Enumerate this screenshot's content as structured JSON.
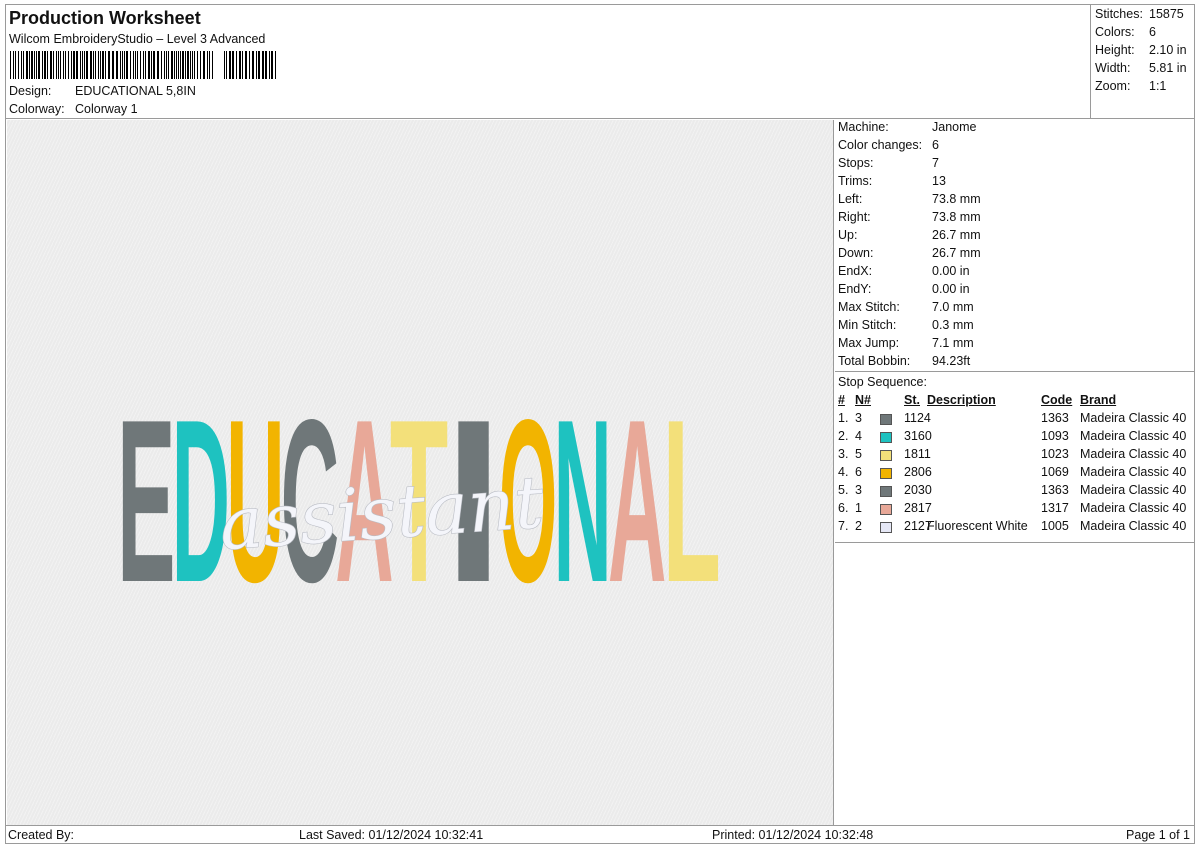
{
  "header": {
    "title": "Production Worksheet",
    "subtitle": "Wilcom EmbroideryStudio – Level 3 Advanced",
    "design_label": "Design:",
    "design_value": "EDUCATIONAL 5,8IN",
    "colorway_label": "Colorway:",
    "colorway_value": "Colorway 1"
  },
  "stats": [
    {
      "label": "Stitches:",
      "value": "15875"
    },
    {
      "label": "Colors:",
      "value": "6"
    },
    {
      "label": "Height:",
      "value": "2.10 in"
    },
    {
      "label": "Width:",
      "value": "5.81 in"
    },
    {
      "label": "Zoom:",
      "value": "1:1"
    }
  ],
  "machine_info": [
    {
      "label": "Machine:",
      "value": "Janome"
    },
    {
      "label": "Color changes:",
      "value": "6"
    },
    {
      "label": "Stops:",
      "value": "7"
    },
    {
      "label": "Trims:",
      "value": "13"
    },
    {
      "label": "Left:",
      "value": "73.8 mm"
    },
    {
      "label": "Right:",
      "value": "73.8 mm"
    },
    {
      "label": "Up:",
      "value": "26.7 mm"
    },
    {
      "label": "Down:",
      "value": "26.7 mm"
    },
    {
      "label": "EndX:",
      "value": "0.00 in"
    },
    {
      "label": "EndY:",
      "value": "0.00 in"
    },
    {
      "label": "Max Stitch:",
      "value": "7.0 mm"
    },
    {
      "label": "Min Stitch:",
      "value": "0.3 mm"
    },
    {
      "label": "Max Jump:",
      "value": "7.1 mm"
    },
    {
      "label": "Total Bobbin:",
      "value": "94.23ft"
    }
  ],
  "stop_sequence": {
    "title": "Stop Sequence:",
    "headers": {
      "num": "#",
      "needle": "N#",
      "stitches": "St.",
      "description": "Description",
      "code": "Code",
      "brand": "Brand"
    },
    "rows": [
      {
        "num": "1.",
        "needle": "3",
        "color": "#6f7779",
        "stitches": "1124",
        "description": "",
        "code": "1363",
        "brand": "Madeira Classic 40"
      },
      {
        "num": "2.",
        "needle": "4",
        "color": "#1ec2c0",
        "stitches": "3160",
        "description": "",
        "code": "1093",
        "brand": "Madeira Classic 40"
      },
      {
        "num": "3.",
        "needle": "5",
        "color": "#f3e07a",
        "stitches": "1811",
        "description": "",
        "code": "1023",
        "brand": "Madeira Classic 40"
      },
      {
        "num": "4.",
        "needle": "6",
        "color": "#f2b400",
        "stitches": "2806",
        "description": "",
        "code": "1069",
        "brand": "Madeira Classic 40"
      },
      {
        "num": "5.",
        "needle": "3",
        "color": "#6f7779",
        "stitches": "2030",
        "description": "",
        "code": "1363",
        "brand": "Madeira Classic 40"
      },
      {
        "num": "6.",
        "needle": "1",
        "color": "#e8a898",
        "stitches": "2817",
        "description": "",
        "code": "1317",
        "brand": "Madeira Classic 40"
      },
      {
        "num": "7.",
        "needle": "2",
        "color": "#e6e8f6",
        "stitches": "2127",
        "description": "Fluorescent White",
        "code": "1005",
        "brand": "Madeira Classic 40"
      }
    ]
  },
  "footer": {
    "created_by": "Created By:",
    "last_saved": "Last Saved: 01/12/2024 10:32:41",
    "printed": "Printed: 01/12/2024 10:32:48",
    "page": "Page 1 of 1"
  },
  "design_preview": {
    "main_word": "EDUCATIONAL",
    "script_word": "assistant",
    "letter_colors": [
      "#6f7779",
      "#1ec2c0",
      "#f2b400",
      "#6f7779",
      "#e8a898",
      "#f3e07a",
      "#6f7779",
      "#f2b400",
      "#1ec2c0",
      "#e8a898",
      "#f3e07a"
    ],
    "script_color": "#f4f5fa"
  }
}
